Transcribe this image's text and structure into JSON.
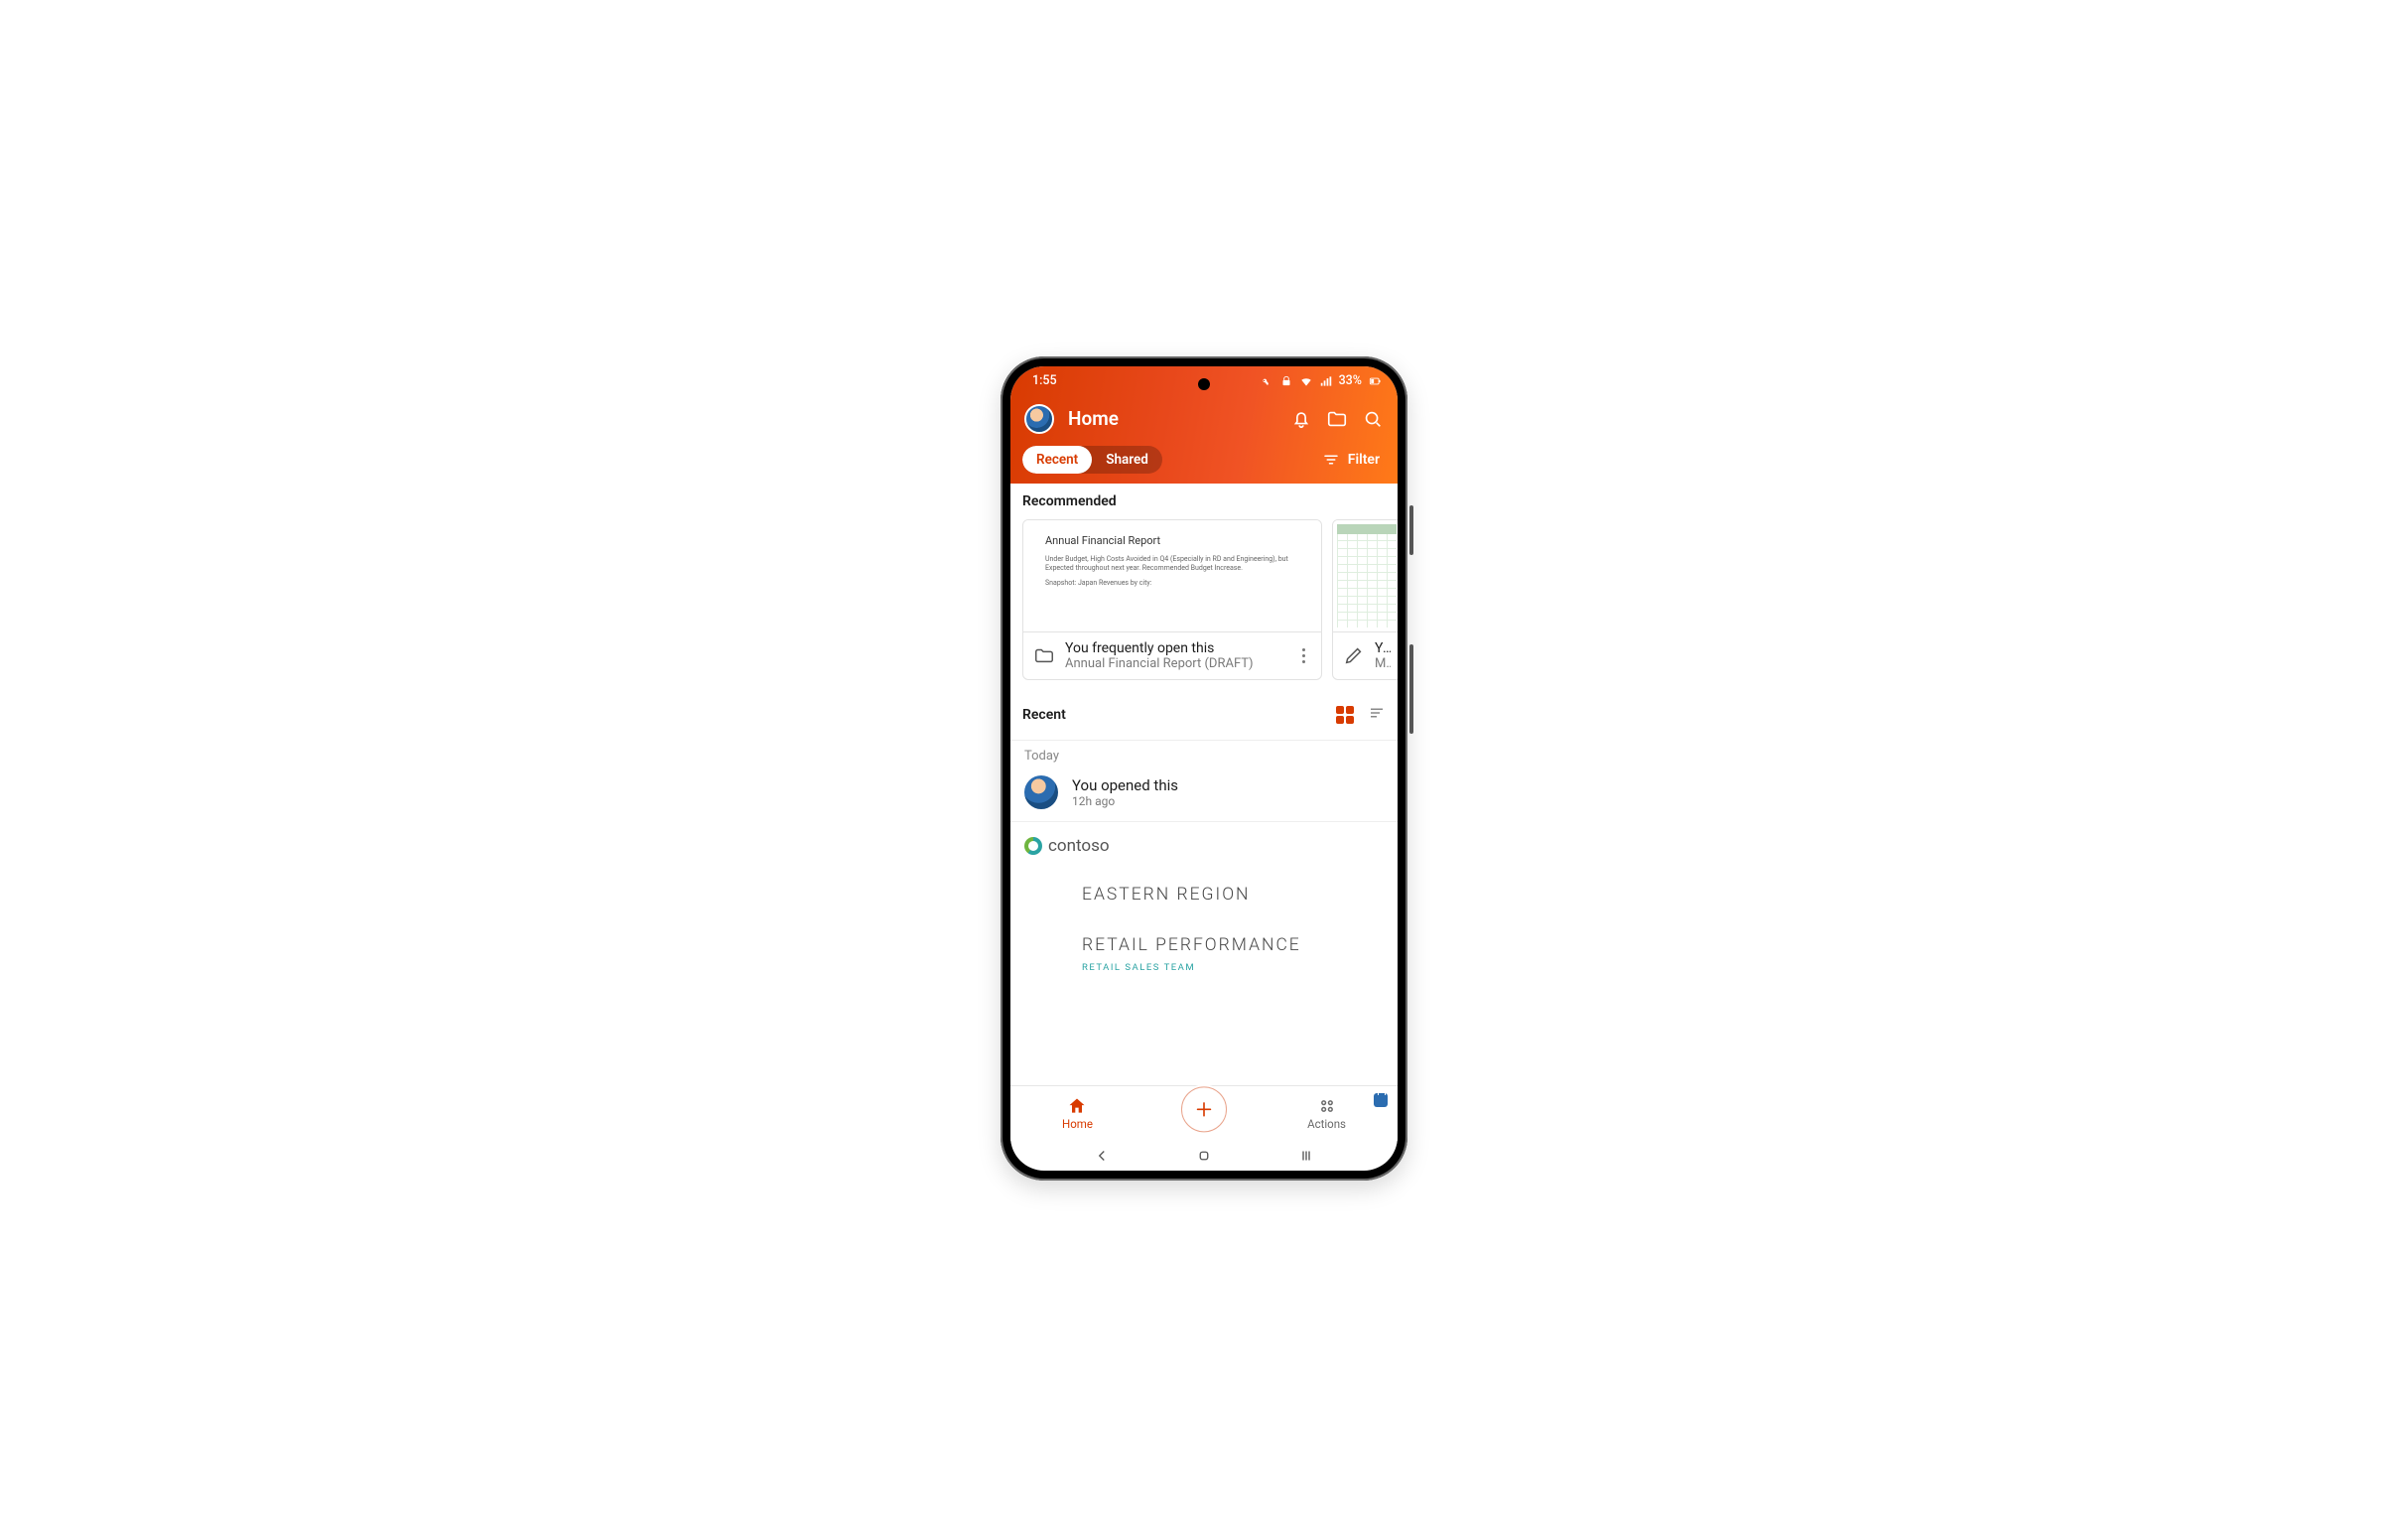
{
  "statusbar": {
    "time": "1:55",
    "battery_text": "33%"
  },
  "appbar": {
    "title": "Home"
  },
  "tabs": {
    "recent": "Recent",
    "shared": "Shared",
    "filter": "Filter"
  },
  "recommended": {
    "label": "Recommended",
    "card1": {
      "preview_title": "Annual Financial Report",
      "preview_line1": "Under Budget, High Costs Avoided in Q4 (Especially in RD and Engineering), but Expected throughout next year.  Recommended Budget Increase.",
      "preview_line2": "Snapshot: Japan Revenues by city:",
      "reason": "You frequently open this",
      "subtitle": "Annual Financial Report (DRAFT)"
    },
    "card2": {
      "reason": "You",
      "subtitle": "Mar"
    }
  },
  "recent": {
    "label": "Recent",
    "today": "Today",
    "activity_title": "You opened this",
    "activity_time": "12h ago",
    "brand": "contoso",
    "doc_line1": "EASTERN REGION",
    "doc_line2": "RETAIL PERFORMANCE",
    "doc_sub": "RETAIL SALES TEAM"
  },
  "bottom": {
    "home": "Home",
    "actions": "Actions"
  }
}
